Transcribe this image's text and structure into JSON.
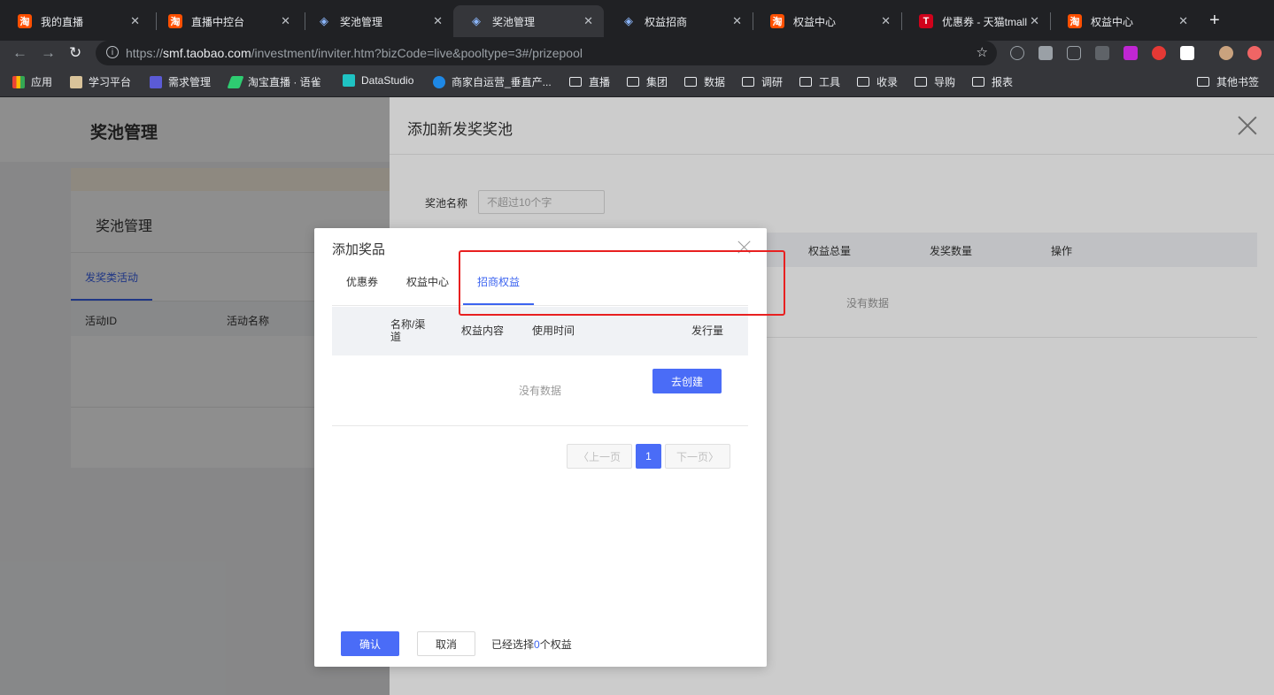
{
  "browser": {
    "tabs": [
      {
        "title": "我的直播",
        "favicon": "淘"
      },
      {
        "title": "直播中控台",
        "favicon": "淘"
      },
      {
        "title": "奖池管理",
        "favicon": "◈"
      },
      {
        "title": "奖池管理",
        "favicon": "◈"
      },
      {
        "title": "权益招商",
        "favicon": "◈"
      },
      {
        "title": "权益中心",
        "favicon": "淘"
      },
      {
        "title": "优惠券 - 天猫tmall",
        "favicon": "T"
      },
      {
        "title": "权益中心",
        "favicon": "淘"
      }
    ],
    "close_glyph": "✕",
    "new_tab_glyph": "+",
    "url_scheme": "https://",
    "url_host": "smf.taobao.com",
    "url_rest": "/investment/inviter.htm?bizCode=live&pooltype=3#/prizepool",
    "bookmarks": [
      "应用",
      "学习平台",
      "需求管理",
      "淘宝直播 · 语雀",
      "DataStudio",
      "商家自运营_垂直产...",
      "直播",
      "集团",
      "数据",
      "调研",
      "工具",
      "收录",
      "导购",
      "报表"
    ],
    "other_bookmarks": "其他书签"
  },
  "page": {
    "title": "奖池管理",
    "card_title": "奖池管理",
    "tab": "发奖类活动",
    "columns": [
      "活动ID",
      "活动名称"
    ]
  },
  "drawer": {
    "title": "添加新发奖奖池",
    "name_label": "奖池名称",
    "name_placeholder": "不超过10个字",
    "columns": [
      "权益总量",
      "发奖数量",
      "操作"
    ],
    "empty": "没有数据"
  },
  "modal": {
    "title": "添加奖品",
    "tabs": [
      "优惠券",
      "权益中心",
      "招商权益"
    ],
    "active_tab": "招商权益",
    "create_button": "去创建",
    "columns": [
      "名称/渠道",
      "权益内容",
      "使用时间",
      "发行量"
    ],
    "empty": "没有数据",
    "pager": {
      "prev": "上一页",
      "current": "1",
      "next": "下一页"
    },
    "confirm": "确认",
    "cancel": "取消",
    "selected_prefix": "已经选择",
    "selected_count": "0",
    "selected_suffix": "个权益"
  },
  "colors": {
    "accent": "#4a6cf7",
    "annotation": "#e82020"
  }
}
